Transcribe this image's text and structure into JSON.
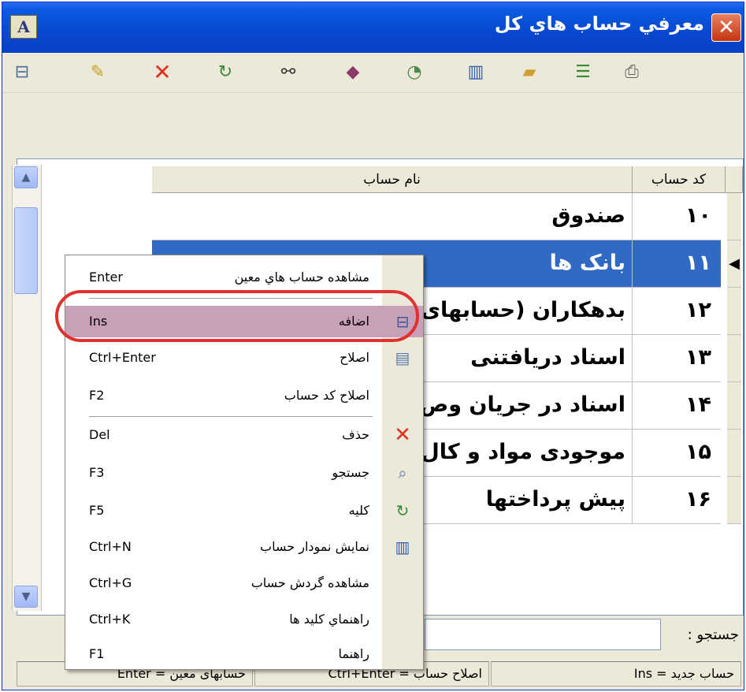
{
  "window": {
    "title": "معرفي حساب هاي کل",
    "app_icon_letter": "A",
    "close_glyph": "✕"
  },
  "toolbar": {
    "icons": [
      "tree-icon",
      "pencil-icon",
      "delete-icon",
      "refresh-icon",
      "binoculars-icon",
      "book-icon",
      "gauge-icon",
      "chart-icon",
      "folder-open-icon",
      "list-icon",
      "print-icon"
    ]
  },
  "grid": {
    "columns": {
      "code": "کد حساب",
      "name": "نام حساب"
    },
    "rows": [
      {
        "code": "۱۰",
        "name": "صندوق"
      },
      {
        "code": "۱۱",
        "name": "بانک ها"
      },
      {
        "code": "۱۲",
        "name": "بدهکاران (حسابهای"
      },
      {
        "code": "۱۳",
        "name": "اسناد دریافتنی"
      },
      {
        "code": "۱۴",
        "name": "اسناد در جریان وص"
      },
      {
        "code": "۱۵",
        "name": "موجودی مواد و کال"
      },
      {
        "code": "۱۶",
        "name": "پیش پرداختها"
      }
    ],
    "selected_index": 1
  },
  "search": {
    "label": "جستجو :",
    "value": ""
  },
  "status": {
    "cells": [
      "حساب جدید = Ins",
      "اصلاح حساب = Ctrl+Enter",
      "حسابهای معین = Enter"
    ]
  },
  "context_menu": {
    "items": [
      {
        "label": "مشاهده حساب هاي معين",
        "key": "Enter",
        "icon": ""
      },
      {
        "label": "اضافه",
        "key": "Ins",
        "icon": "add-tree-icon"
      },
      {
        "label": "اصلاح",
        "key": "Ctrl+Enter",
        "icon": "edit-doc-icon"
      },
      {
        "label": "اصلاح کد حساب",
        "key": "F2",
        "icon": ""
      },
      {
        "label": "حذف",
        "key": "Del",
        "icon": "delete-icon"
      },
      {
        "label": "جستجو",
        "key": "F3",
        "icon": "search-doc-icon"
      },
      {
        "label": "کليه",
        "key": "F5",
        "icon": "refresh-icon"
      },
      {
        "label": "نمايش نمودار حساب",
        "key": "Ctrl+N",
        "icon": "chart-icon"
      },
      {
        "label": "مشاهده گردش حساب",
        "key": "Ctrl+G",
        "icon": ""
      },
      {
        "label": "راهنماي کليد ها",
        "key": "Ctrl+K",
        "icon": ""
      },
      {
        "label": "راهنما",
        "key": "F1",
        "icon": ""
      }
    ],
    "highlighted_index": 1
  }
}
